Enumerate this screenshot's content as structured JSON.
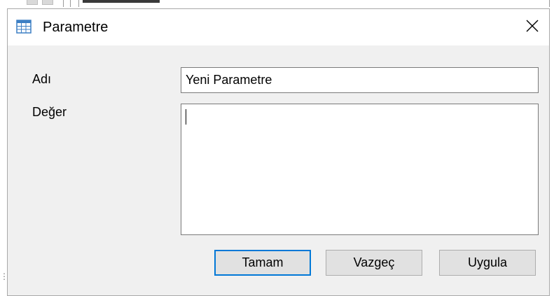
{
  "window": {
    "title": "Parametre",
    "icon": "table-icon",
    "close_icon": "close-icon"
  },
  "form": {
    "name_label": "Adı",
    "name_value": "Yeni Parametre",
    "value_label": "Değer",
    "value_value": ""
  },
  "buttons": {
    "ok_label": "Tamam",
    "cancel_label": "Vazgeç",
    "apply_label": "Uygula"
  },
  "colors": {
    "focus_border": "#0078d7",
    "dialog_bg": "#f0f0f0",
    "button_bg": "#e1e1e1"
  }
}
